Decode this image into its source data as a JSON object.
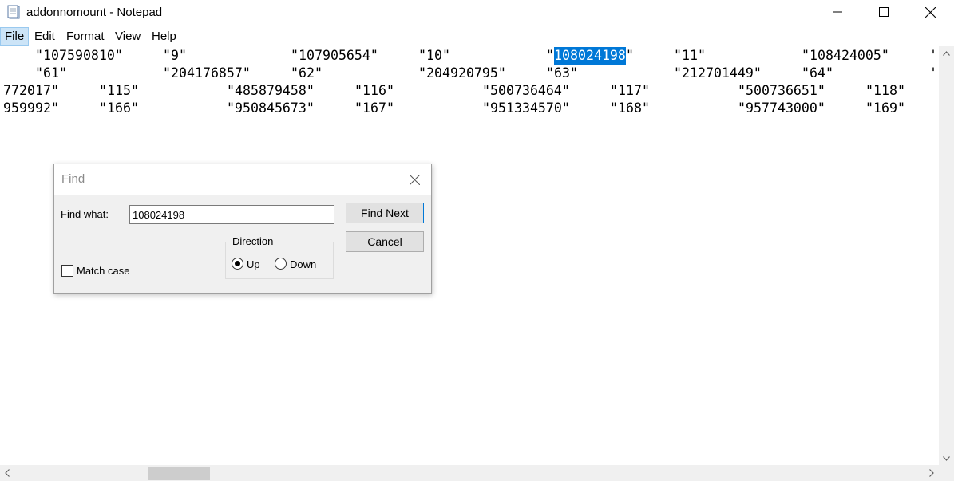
{
  "window": {
    "title": "addonnomount - Notepad",
    "app_icon": "notepad-icon",
    "controls": [
      "minimize-icon",
      "maximize-icon",
      "close-icon"
    ]
  },
  "menu": {
    "items": [
      {
        "label": "File",
        "active": true
      },
      {
        "label": "Edit"
      },
      {
        "label": "Format"
      },
      {
        "label": "View"
      },
      {
        "label": "Help"
      }
    ]
  },
  "editor": {
    "selection_color": "#0078d7",
    "lines": [
      {
        "cells": [
          "\"107590810\"",
          "\"9\"",
          "\"107905654\"",
          "\"10\"",
          "\"",
          "108024198",
          "\"",
          "\"11\"",
          "\"108424005\"",
          "'"
        ]
      },
      {
        "cells": [
          "\"61\"",
          "\"204176857\"",
          "\"62\"",
          "\"204920795\"",
          "\"63\"",
          "\"212701449\"",
          "\"64\"",
          "'"
        ]
      },
      {
        "cells": [
          "772017\"",
          "\"115\"",
          "\"485879458\"",
          "\"116\"",
          "\"500736464\"",
          "\"117\"",
          "\"500736651\"",
          "\"118\""
        ]
      },
      {
        "cells": [
          "959992\"",
          "\"166\"",
          "\"950845673\"",
          "\"167\"",
          "\"951334570\"",
          "\"168\"",
          "\"957743000\"",
          "\"169\""
        ]
      }
    ]
  },
  "find_dialog": {
    "title": "Find",
    "find_what_label": "Find what:",
    "find_what_value": "108024198",
    "find_next_label": "Find Next",
    "cancel_label": "Cancel",
    "direction_label": "Direction",
    "up_label": "Up",
    "down_label": "Down",
    "direction_selected": "Up",
    "match_case_label": "Match case",
    "match_case_checked": false
  }
}
